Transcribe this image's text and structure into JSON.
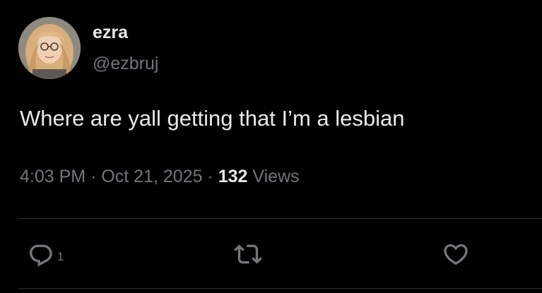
{
  "user": {
    "display_name": "ezra",
    "handle": "@ezbruj"
  },
  "tweet": {
    "text": "Where are yall getting that I’m a lesbian",
    "time": "4:03 PM",
    "separator": "·",
    "date": "Oct 21, 2025",
    "views_count": "132",
    "views_label": "Views"
  },
  "actions": {
    "reply_count": "1"
  },
  "colors": {
    "background": "#000000",
    "primary_text": "#e7e9ea",
    "secondary_text": "#71767b",
    "divider": "#2f3336"
  },
  "icons": {
    "reply": "reply-icon",
    "retweet": "retweet-icon",
    "like": "heart-icon"
  }
}
